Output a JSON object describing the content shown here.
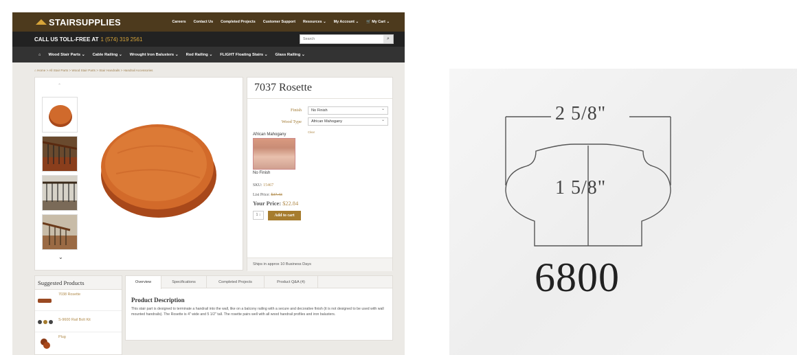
{
  "header": {
    "logo": "STAIRSUPPLIES",
    "nav": [
      "Careers",
      "Contact Us",
      "Completed Projects",
      "Customer Support",
      "Resources ⌄",
      "My Account ⌄",
      "🛒 My Cart ⌄"
    ],
    "call_label": "CALL US TOLL-FREE AT",
    "phone": "1 (574) 319 2561",
    "search_placeholder": "Search",
    "home_icon": "home-icon",
    "categories": [
      "Wood Stair Parts ⌄",
      "Cable Railing ⌄",
      "Wrought Iron Balusters ⌄",
      "Rod Railing ⌄",
      "FLIGHT Floating Stairs ⌄",
      "Glass Railing ⌄"
    ]
  },
  "breadcrumb": "⌂ Home > All Stair Parts > Wood Stair Parts > Stair Handrails > Handrail Accessories",
  "product": {
    "title": "7037 Rosette",
    "finish_label": "Finish",
    "finish_value": "No Finish",
    "wood_label": "Wood Type",
    "wood_value": "African Mahogany",
    "clear": "Clear",
    "swatch_top": "African Mahogany",
    "swatch_bottom": "No Finish",
    "sku_label": "SKU:",
    "sku": "15467",
    "list_label": "List Price:",
    "list_price": "$37.43",
    "your_label": "Your Price:",
    "your_price": "$22.84",
    "qty": "1 ↕",
    "add_to_cart": "Add to cart",
    "ships": "Ships in approx 10 Business Days"
  },
  "suggested": {
    "title": "Suggested Products",
    "items": [
      "7038 Rosette",
      "S-9600 Rail Bolt Kit",
      "Plug"
    ]
  },
  "tabs": {
    "labels": [
      "Overview",
      "Specifications",
      "Completed Projects",
      "Product Q&A (4)"
    ],
    "desc_title": "Product Description",
    "desc_body": "This stair part is designed to terminate a handrail into the wall, like on a balcony railing with a secure and decorative finish (it is not designed to be used with wall mounted handrails). The Rosette is 4\" wide and 5 1/2\" tall. The rosette pairs well with all wood handrail profiles and iron balusters."
  },
  "drawing": {
    "width_dim": "2 5/8\"",
    "height_dim": "1 5/8\"",
    "part_number": "6800"
  }
}
